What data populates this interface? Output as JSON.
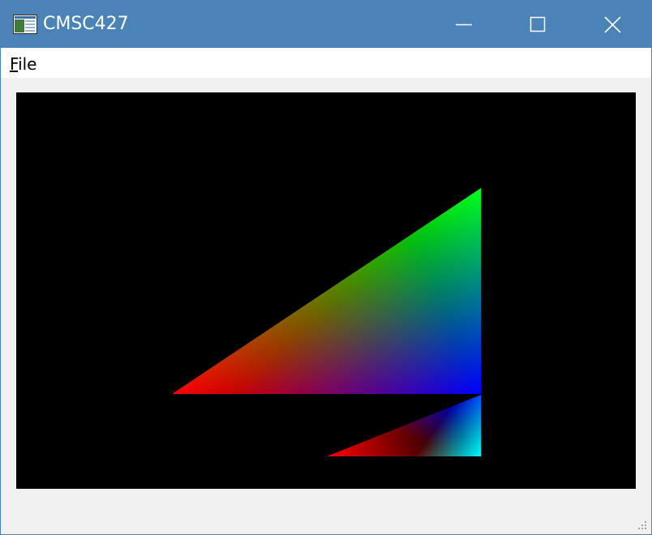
{
  "window": {
    "title": "CMSC427",
    "titlebar_color": "#4a83b7",
    "app_icon": "application-window-icon"
  },
  "controls": {
    "minimize_icon": "minimize-icon",
    "maximize_icon": "maximize-icon",
    "close_icon": "close-icon"
  },
  "menubar": {
    "items": [
      {
        "label": "File",
        "mnemonic": "F",
        "rest": "ile"
      }
    ]
  },
  "canvas": {
    "background": "#000000",
    "triangles": [
      {
        "name": "large-triangle",
        "vertex_colors": [
          "#ff0000",
          "#00ff00",
          "#0000ff"
        ]
      },
      {
        "name": "small-triangle",
        "vertex_colors": [
          "#ff0000",
          "#0000ff",
          "#00ffff"
        ]
      }
    ]
  },
  "statusbar": {
    "grip_icon": "size-grip-icon"
  }
}
